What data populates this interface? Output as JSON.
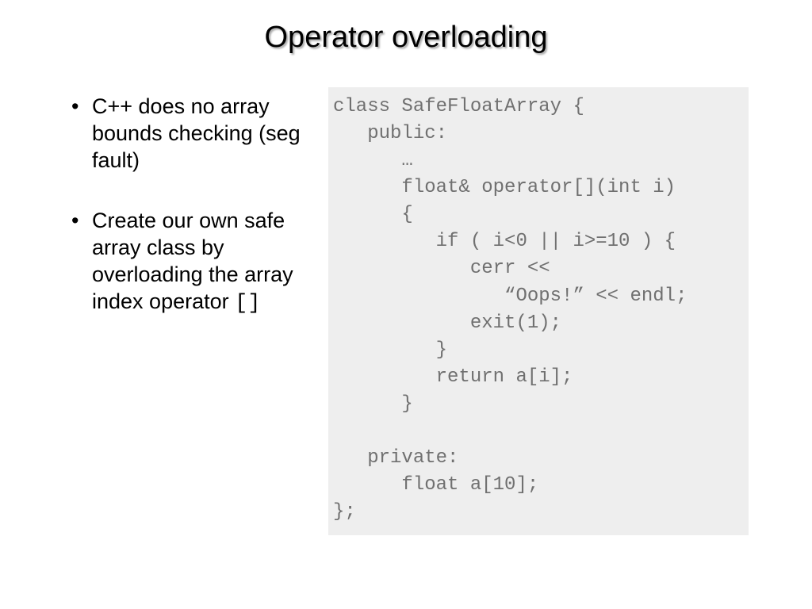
{
  "title": "Operator overloading",
  "bullets": [
    {
      "text": "C++ does no array bounds checking (seg fault)",
      "mono_suffix": ""
    },
    {
      "text": "Create our own safe array class by overloading the array index operator ",
      "mono_suffix": "[]"
    }
  ],
  "code": "class SafeFloatArray {\n   public:\n      …\n      float& operator[](int i)\n      {\n         if ( i<0 || i>=10 ) {\n            cerr <<\n               “Oops!” << endl;\n            exit(1);\n         }\n         return a[i];\n      }\n\n   private:\n      float a[10];\n};"
}
